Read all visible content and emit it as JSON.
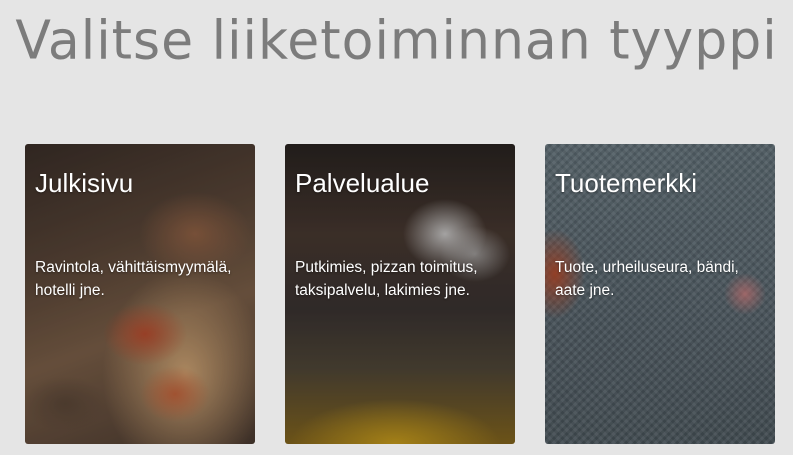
{
  "page": {
    "title": "Valitse liiketoiminnan tyyppi"
  },
  "cards": [
    {
      "heading": "Julkisivu",
      "description": "Ravintola, vähittäismyymälä, hotelli jne."
    },
    {
      "heading": "Palvelualue",
      "description": "Putkimies, pizzan toimitus, taksipalvelu, lakimies jne."
    },
    {
      "heading": "Tuotemerkki",
      "description": "Tuote, urheiluseura, bändi, aate jne."
    }
  ]
}
